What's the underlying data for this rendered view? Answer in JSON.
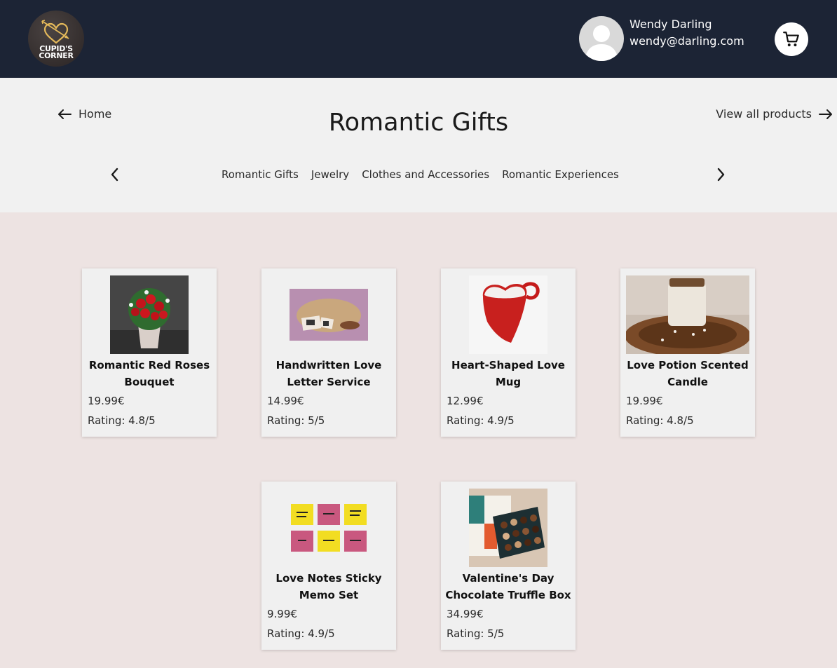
{
  "header": {
    "logo_line1": "CUPID'S",
    "logo_line2": "CORNER",
    "user_name": "Wendy Darling",
    "user_email": "wendy@darling.com",
    "cart_icon": "cart-icon"
  },
  "nav": {
    "home_label": "Home",
    "view_all_label": "View all products",
    "page_title": "Romantic Gifts",
    "categories": [
      "Romantic Gifts",
      "Jewelry",
      "Clothes and Accessories",
      "Romantic Experiences"
    ]
  },
  "products": [
    {
      "name": "Romantic Red Roses Bouquet",
      "price": "19.99€",
      "rating": "Rating: 4.8/5"
    },
    {
      "name": "Handwritten Love Letter Service",
      "price": "14.99€",
      "rating": "Rating: 5/5"
    },
    {
      "name": "Heart-Shaped Love Mug",
      "price": "12.99€",
      "rating": "Rating: 4.9/5"
    },
    {
      "name": "Love Potion Scented Candle",
      "price": "19.99€",
      "rating": "Rating: 4.8/5"
    },
    {
      "name": "Love Notes Sticky Memo Set",
      "price": "9.99€",
      "rating": "Rating: 4.9/5"
    },
    {
      "name": "Valentine's Day Chocolate Truffle Box",
      "price": "34.99€",
      "rating": "Rating: 5/5"
    }
  ],
  "colors": {
    "topbar": "#1c2435",
    "subheader": "#f1f1f1",
    "page_bg": "#ede3e2",
    "card_bg": "#f0f0f0"
  }
}
